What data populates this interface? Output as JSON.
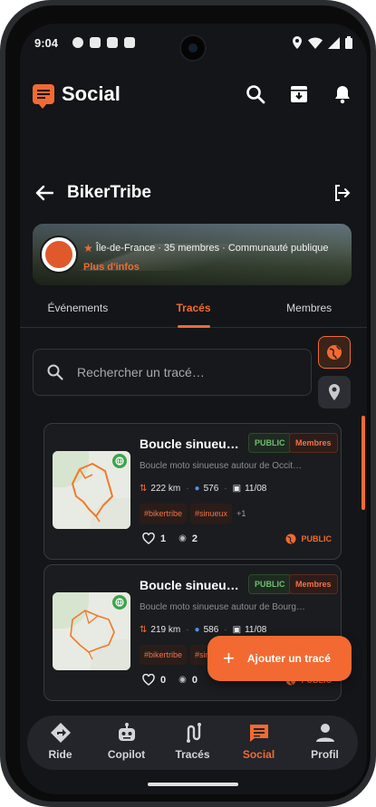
{
  "status_bar": {
    "time": "9:04"
  },
  "app_bar": {
    "title": "Social",
    "actions": [
      "search-icon",
      "archive-icon",
      "bell-icon"
    ]
  },
  "group": {
    "name": "BikerTribe",
    "meta": "Île-de-France · 35 membres · Communauté publique",
    "more_info": "Plus d'infos"
  },
  "tabs": [
    {
      "label": "Événements",
      "active": false
    },
    {
      "label": "Tracés",
      "active": true
    },
    {
      "label": "Membres",
      "active": false
    }
  ],
  "search": {
    "placeholder": "Rechercher un tracé…"
  },
  "tracks": [
    {
      "title": "Boucle sinueuse…",
      "badge_public": "PUBLIC",
      "badge_members": "Membres",
      "description": "Boucle moto sinueuse autour de Occit…",
      "distance": "222 km",
      "waypoints": "576",
      "date": "11/08",
      "tags": [
        "#bikertribe",
        "#sinueux"
      ],
      "tags_more": "+1",
      "likes": "1",
      "views": "2",
      "visibility": "PUBLIC"
    },
    {
      "title": "Boucle sinueuse…",
      "badge_public": "PUBLIC",
      "badge_members": "Membres",
      "description": "Boucle moto sinueuse autour de Bourg…",
      "distance": "219 km",
      "waypoints": "586",
      "date": "11/08",
      "tags": [
        "#bikertribe",
        "#sinueux"
      ],
      "tags_more": "",
      "likes": "0",
      "views": "0",
      "visibility": "PUBLIC"
    }
  ],
  "fab": {
    "label": "Ajouter un tracé"
  },
  "bottom_nav": [
    {
      "label": "Ride",
      "icon": "directions-icon",
      "active": false
    },
    {
      "label": "Copilot",
      "icon": "robot-icon",
      "active": false
    },
    {
      "label": "Tracés",
      "icon": "route-icon",
      "active": false
    },
    {
      "label": "Social",
      "icon": "chat-icon",
      "active": true
    },
    {
      "label": "Profil",
      "icon": "person-icon",
      "active": false
    }
  ],
  "colors": {
    "accent": "#f26a32",
    "background": "#141518",
    "public_green": "#3fa34d",
    "nav_bg": "#23252a"
  }
}
